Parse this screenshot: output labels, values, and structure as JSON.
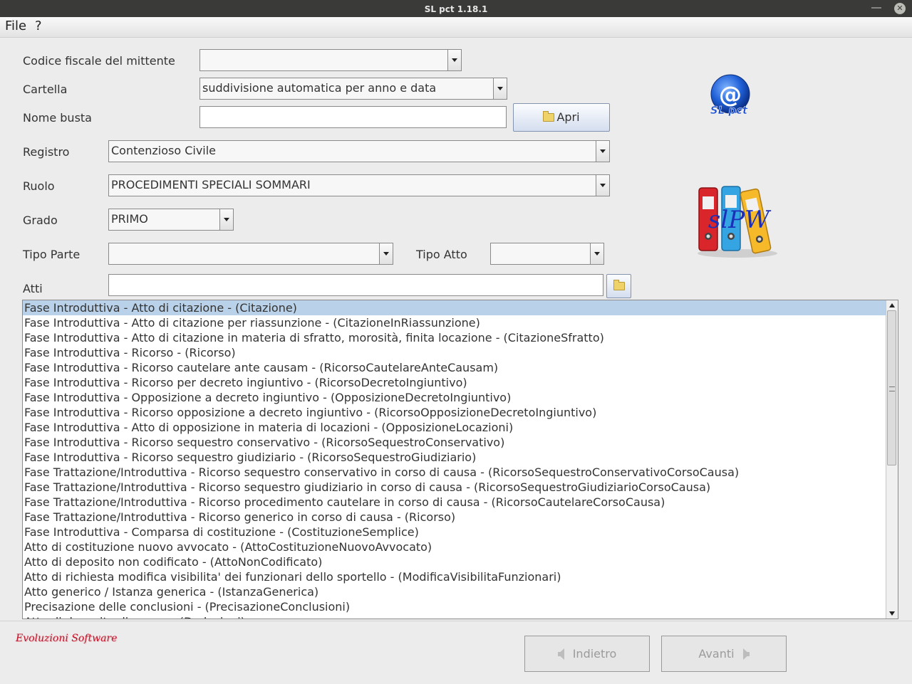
{
  "window": {
    "title": "SL pct 1.18.1"
  },
  "menu": {
    "file": "File",
    "help": "?"
  },
  "form": {
    "codice_fiscale_label": "Codice fiscale del mittente",
    "codice_fiscale_value": "",
    "cartella_label": "Cartella",
    "cartella_value": "suddivisione automatica per anno e data",
    "nome_busta_label": "Nome busta",
    "nome_busta_value": "",
    "apri_label": "Apri",
    "registro_label": "Registro",
    "registro_value": "Contenzioso Civile",
    "ruolo_label": "Ruolo",
    "ruolo_value": "PROCEDIMENTI SPECIALI SOMMARI",
    "grado_label": "Grado",
    "grado_value": "PRIMO",
    "tipo_parte_label": "Tipo Parte",
    "tipo_parte_value": "",
    "tipo_atto_label": "Tipo Atto",
    "tipo_atto_value": "",
    "atti_label": "Atti",
    "atti_value": ""
  },
  "logos": {
    "slpct_text": "SL pct",
    "slpw_text": "slPW",
    "at_sign": "@"
  },
  "atti_list": {
    "selected_index": 0,
    "items": [
      "Fase Introduttiva - Atto di citazione - (Citazione)",
      "Fase Introduttiva - Atto di citazione per riassunzione - (CitazioneInRiassunzione)",
      "Fase Introduttiva - Atto di citazione in materia di sfratto, morosità, finita locazione - (CitazioneSfratto)",
      "Fase Introduttiva - Ricorso - (Ricorso)",
      "Fase Introduttiva - Ricorso cautelare ante causam - (RicorsoCautelareAnteCausam)",
      "Fase Introduttiva - Ricorso per decreto ingiuntivo - (RicorsoDecretoIngiuntivo)",
      "Fase Introduttiva - Opposizione a decreto ingiuntivo - (OpposizioneDecretoIngiuntivo)",
      "Fase Introduttiva - Ricorso opposizione a decreto ingiuntivo - (RicorsoOpposizioneDecretoIngiuntivo)",
      "Fase Introduttiva - Atto di opposizione in materia di locazioni - (OpposizioneLocazioni)",
      "Fase Introduttiva - Ricorso sequestro conservativo - (RicorsoSequestroConservativo)",
      "Fase Introduttiva - Ricorso sequestro giudiziario - (RicorsoSequestroGiudiziario)",
      "Fase Trattazione/Introduttiva - Ricorso sequestro conservativo in corso di causa - (RicorsoSequestroConservativoCorsoCausa)",
      "Fase Trattazione/Introduttiva - Ricorso sequestro giudiziario in corso di causa - (RicorsoSequestroGiudiziarioCorsoCausa)",
      "Fase Trattazione/Introduttiva - Ricorso procedimento cautelare in corso di causa - (RicorsoCautelareCorsoCausa)",
      "Fase Trattazione/Introduttiva - Ricorso generico in corso di causa - (Ricorso)",
      "Fase Introduttiva - Comparsa di costituzione - (CostituzioneSemplice)",
      "Atto di costituzione nuovo avvocato - (AttoCostituzioneNuovoAvvocato)",
      "Atto di deposito non codificato - (AttoNonCodificato)",
      "Atto di richiesta modifica visibilita' dei funzionari dello sportello - (ModificaVisibilitaFunzionari)",
      "Atto generico / Istanza generica - (IstanzaGenerica)",
      "Precisazione delle conclusioni - (PrecisazioneConclusioni)",
      "Atto di deposito di una ... - (Deduzioni)"
    ]
  },
  "footer": {
    "brand": "Evoluzioni Software",
    "back_label": "Indietro",
    "next_label": "Avanti"
  },
  "colors": {
    "selection": "#b9d2ea",
    "brand": "#c0152a",
    "titlebar": "#3a3a38"
  }
}
